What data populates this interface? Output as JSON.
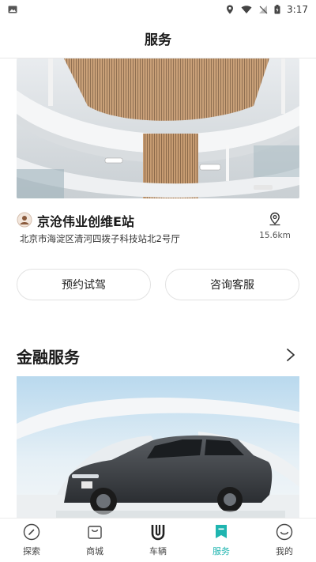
{
  "status_bar": {
    "time": "3:17",
    "icons": [
      "image-icon",
      "location-icon",
      "wifi-icon",
      "signal-icon",
      "battery-icon"
    ]
  },
  "header": {
    "title": "服务"
  },
  "store": {
    "name": "京沧伟业创维E站",
    "address": "北京市海淀区清河四拨子科技站北2号厅",
    "distance": "15.6km"
  },
  "actions": {
    "test_drive": "预约试驾",
    "consult": "咨询客服"
  },
  "finance": {
    "title": "金融服务"
  },
  "bottom_nav": {
    "items": [
      {
        "label": "探索",
        "icon": "compass-icon"
      },
      {
        "label": "商城",
        "icon": "shop-bag-icon"
      },
      {
        "label": "车辆",
        "icon": "vehicle-logo-icon"
      },
      {
        "label": "服务",
        "icon": "service-flag-icon"
      },
      {
        "label": "我的",
        "icon": "profile-face-icon"
      }
    ],
    "active_index": 3
  },
  "colors": {
    "accent": "#1fb5b0",
    "text_primary": "#1a1a1a",
    "border": "#e2e2e2"
  }
}
